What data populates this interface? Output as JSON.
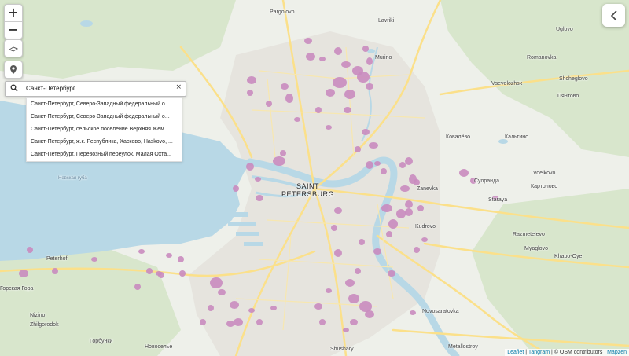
{
  "map": {
    "city_label_line1": "SAINT",
    "city_label_line2": "PETERSBURG",
    "colors": {
      "land": "#eef0ea",
      "water": "#b8d8e6",
      "forest": "#d8e6cc",
      "road": "#fbe08a",
      "urban": "#e4e2dc",
      "marker": "#c98bbf"
    },
    "places": [
      {
        "name": "Pargolovo",
        "id": "pargolovo"
      },
      {
        "name": "Lavriki",
        "id": "lavriki"
      },
      {
        "name": "Uglovo",
        "id": "uglovo"
      },
      {
        "name": "Murino",
        "id": "murino"
      },
      {
        "name": "Romanovka",
        "id": "romanovka"
      },
      {
        "name": "Shcheglovo",
        "id": "shcheglovo"
      },
      {
        "name": "Vsevolozhsk",
        "id": "vsevolozhsk"
      },
      {
        "name": "Пянтово",
        "id": "pyantovo"
      },
      {
        "name": "Ковалёво",
        "id": "kovalevo"
      },
      {
        "name": "Кальтино",
        "id": "kaltino"
      },
      {
        "name": "Zanevka",
        "id": "zanevka"
      },
      {
        "name": "Суоранда",
        "id": "suoranda"
      },
      {
        "name": "Voeikovo",
        "id": "voeikovo"
      },
      {
        "name": "Картолово",
        "id": "kartolovo"
      },
      {
        "name": "Staraya",
        "id": "staraya"
      },
      {
        "name": "Kudrovo",
        "id": "kudrovo"
      },
      {
        "name": "Razmetelevo",
        "id": "razmetelevo"
      },
      {
        "name": "Myaglovo",
        "id": "myaglovo"
      },
      {
        "name": "Khapo-Oye",
        "id": "khapo-oye"
      },
      {
        "name": "Peterhof",
        "id": "peterhof"
      },
      {
        "name": "Горская Гора",
        "id": "gorskaya-gora"
      },
      {
        "name": "Zhilgorodok",
        "id": "zhilgorodok"
      },
      {
        "name": "Nizino",
        "id": "nizino"
      },
      {
        "name": "Горбунки",
        "id": "gorbunki"
      },
      {
        "name": "Новосельe",
        "id": "novoselye"
      },
      {
        "name": "Novosaratovka",
        "id": "novosaratovka"
      },
      {
        "name": "Shushary",
        "id": "shushary"
      },
      {
        "name": "Metallostroy",
        "id": "metallostroy"
      },
      {
        "name": "Невская губа",
        "id": "nevskaya-guba"
      }
    ]
  },
  "controls": {
    "zoom_in": "+",
    "zoom_out": "−"
  },
  "search": {
    "value": "Санкт-Петербург",
    "clear": "×",
    "suggestions": [
      "Санкт-Петербург, Северо-Западный федеральный о...",
      "Санкт-Петербург, Северо-Западный федеральный о...",
      "Санкт-Петербург, сельское поселение Верхняя Жем...",
      "Санкт-Петербург, ж.к. Республика, Хасково, Haskovo, ...",
      "Санкт-Петербург, Перевозный переулок, Малая Охта..."
    ]
  },
  "attribution": {
    "leaflet": "Leaflet",
    "sep1": " | ",
    "tangram": "Tangram",
    "middle": " | © OSM contributors | ",
    "mapzen": "Mapzen"
  }
}
